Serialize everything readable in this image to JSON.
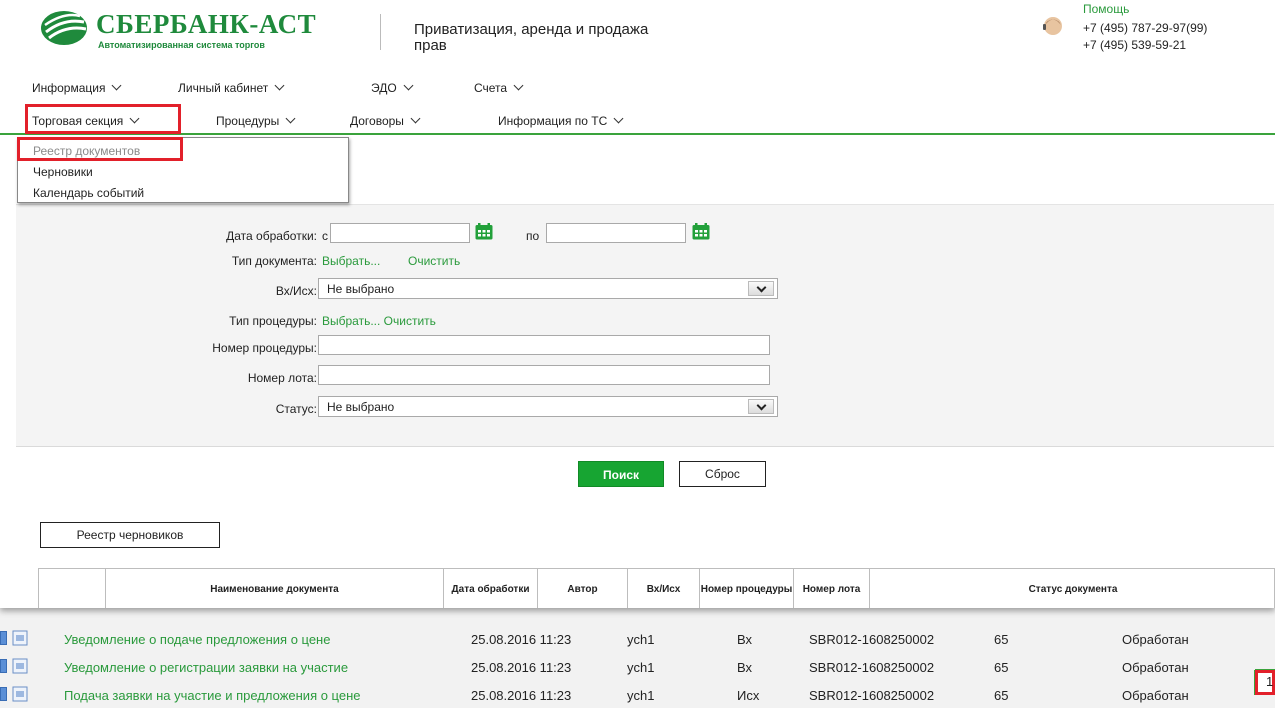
{
  "header": {
    "logo_title": "СБЕРБАНК-АСТ",
    "logo_subtitle": "Автоматизированная система торгов",
    "section_title": "Приватизация, аренда и продажа прав",
    "help_label": "Помощь",
    "phone1": "+7 (495) 787-29-97(99)",
    "phone2": "+7 (495) 539-59-21"
  },
  "menu_row1": [
    "Информация",
    "Личный кабинет",
    "ЭДО",
    "Счета"
  ],
  "menu_row2": [
    "Торговая секция",
    "Процедуры",
    "Договоры",
    "Информация по ТС"
  ],
  "dropdown": [
    "Реестр документов",
    "Черновики",
    "Календарь событий"
  ],
  "filter": {
    "date_label": "Дата обработки:",
    "date_from_prefix": "с",
    "date_to_prefix": "по",
    "doc_type_label": "Тип документа:",
    "choose_link": "Выбрать...",
    "clear_link": "Очистить",
    "inout_label": "Вх/Исх:",
    "inout_value": "Не выбрано",
    "proc_type_label": "Тип процедуры:",
    "proc_choose_clear": "Выбрать... Очистить",
    "proc_number_label": "Номер процедуры:",
    "lot_number_label": "Номер лота:",
    "status_label": "Статус:",
    "status_value": "Не выбрано"
  },
  "buttons": {
    "search": "Поиск",
    "reset": "Сброс",
    "drafts": "Реестр черновиков"
  },
  "table": {
    "headers": [
      "Наименование документа",
      "Дата обработки",
      "Автор",
      "Вх/Исх",
      "Номер процедуры",
      "Номер лота",
      "Статус документа"
    ],
    "rows": [
      {
        "name": "Уведомление о подаче предложения о цене",
        "date": "25.08.2016 11:23",
        "author": "ych1",
        "inout": "Вх",
        "proc": "SBR012-1608250002",
        "lot": "65",
        "status": "Обработан"
      },
      {
        "name": "Уведомление о регистрации заявки на участие",
        "date": "25.08.2016 11:23",
        "author": "ych1",
        "inout": "Вх",
        "proc": "SBR012-1608250002",
        "lot": "65",
        "status": "Обработан"
      },
      {
        "name": "Подача заявки на участие и предложения о цене",
        "date": "25.08.2016 11:23",
        "author": "ych1",
        "inout": "Исх",
        "proc": "SBR012-1608250002",
        "lot": "65",
        "status": "Обработан"
      }
    ]
  },
  "pager": {
    "page": "1"
  },
  "colors": {
    "brand_green": "#1f8a3c",
    "link_green": "#2a9a3c",
    "button_green": "#17a532",
    "highlight_red": "#e2202a"
  }
}
